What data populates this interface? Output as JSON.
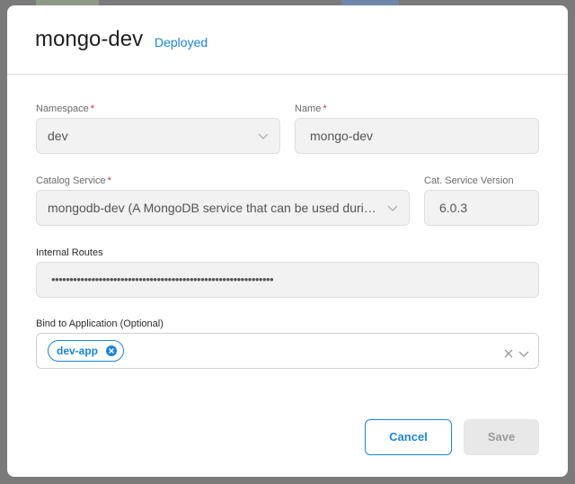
{
  "dialog": {
    "title": "mongo-dev",
    "status": "Deployed"
  },
  "form": {
    "namespace": {
      "label": "Namespace",
      "required_mark": "*",
      "value": "dev"
    },
    "name": {
      "label": "Name",
      "required_mark": "*",
      "value": "mongo-dev"
    },
    "catalog_service": {
      "label": "Catalog Service",
      "required_mark": "*",
      "value": "mongodb-dev (A MongoDB service that can be used during development)"
    },
    "cat_service_version": {
      "label": "Cat. Service Version",
      "value": "6.0.3"
    },
    "internal_routes": {
      "label": "Internal Routes",
      "value": "•••••••••••••••••••••••••••••••••••••••••••••••••••••••••••••"
    },
    "bind_to_application": {
      "label": "Bind to Application (Optional)",
      "chips": [
        "dev-app"
      ]
    }
  },
  "actions": {
    "cancel_label": "Cancel",
    "save_label": "Save"
  },
  "icons": {
    "dropdown": "chevron-down-icon",
    "chip_remove": "close-circle-icon",
    "clear": "close-icon"
  },
  "colors": {
    "accent": "#1a86d9",
    "required": "#c0392b",
    "disabled_bg": "#f2f2f2"
  }
}
